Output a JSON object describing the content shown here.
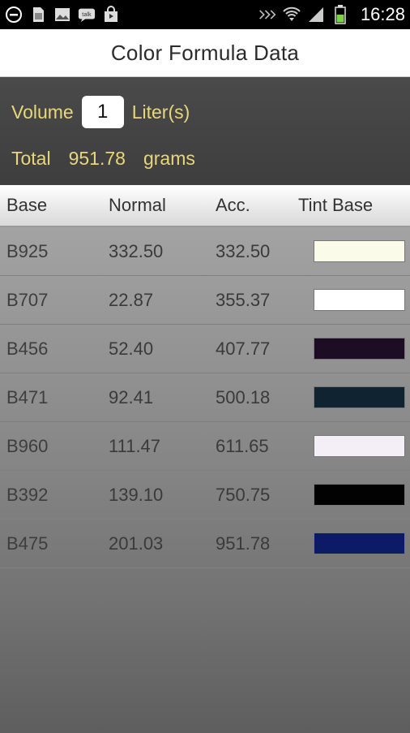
{
  "status_bar": {
    "time": "16:28",
    "left_icons": [
      "minus-circle-icon",
      "sd-card-icon",
      "image-icon",
      "talk-icon",
      "shop-icon"
    ],
    "right_icons": [
      "signal-mute-icon",
      "wifi-icon",
      "cell-signal-icon",
      "battery-icon"
    ],
    "talk_label": "talk"
  },
  "header": {
    "title": "Color Formula Data"
  },
  "volume": {
    "label": "Volume",
    "value": "1",
    "unit": "Liter(s)"
  },
  "total": {
    "label": "Total",
    "value": "951.78",
    "unit": "grams"
  },
  "table": {
    "columns": [
      "Base",
      "Normal",
      "Acc.",
      "Tint Base"
    ],
    "rows": [
      {
        "base": "B925",
        "normal": "332.50",
        "acc": "332.50",
        "color": "#fbfbe9"
      },
      {
        "base": "B707",
        "normal": "22.87",
        "acc": "355.37",
        "color": "#ffffff"
      },
      {
        "base": "B456",
        "normal": "52.40",
        "acc": "407.77",
        "color": "#1c0c24"
      },
      {
        "base": "B471",
        "normal": "92.41",
        "acc": "500.18",
        "color": "#0f2330"
      },
      {
        "base": "B960",
        "normal": "111.47",
        "acc": "611.65",
        "color": "#f4eef6"
      },
      {
        "base": "B392",
        "normal": "139.10",
        "acc": "750.75",
        "color": "#020202"
      },
      {
        "base": "B475",
        "normal": "201.03",
        "acc": "951.78",
        "color": "#0d1a66"
      }
    ]
  },
  "colors": {
    "accent_text": "#e8d77a"
  }
}
